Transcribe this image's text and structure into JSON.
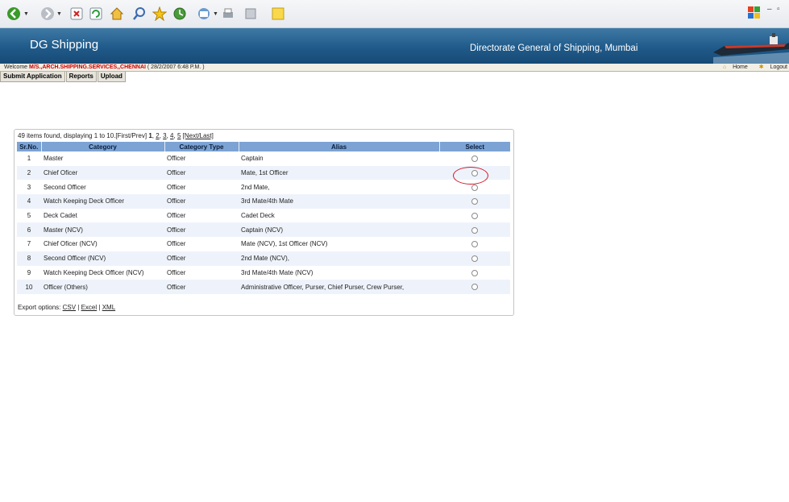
{
  "banner": {
    "title": "DG Shipping",
    "subtitle": "Directorate General of Shipping, Mumbai"
  },
  "welcome": {
    "prefix": "Welcome",
    "company": "M/S.,ARCH.SHIPPING.SERVICES,,CHENNAI",
    "datetime": "( 28/2/2007 6:48 P.M. )",
    "home_label": "Home",
    "logout_label": "Logout"
  },
  "menu": {
    "submit_application": "Submit Application",
    "reports": "Reports",
    "upload": "Upload"
  },
  "pager": {
    "summary": "49 items found, displaying 1 to 10.",
    "first_prev": "[First/Prev]",
    "current": "1",
    "pages": [
      "2",
      "3",
      "4",
      "5"
    ],
    "next_last": "[Next/Last]"
  },
  "table": {
    "headers": {
      "srno": "Sr.No.",
      "category": "Category",
      "category_type": "Category Type",
      "alias": "Alias",
      "select": "Select"
    },
    "rows": [
      {
        "sr": "1",
        "category": "Master",
        "type": "Officer",
        "alias": "Captain"
      },
      {
        "sr": "2",
        "category": "Chief Oficer",
        "type": "Officer",
        "alias": "Mate, 1st Officer"
      },
      {
        "sr": "3",
        "category": "Second Officer",
        "type": "Officer",
        "alias": "2nd Mate,"
      },
      {
        "sr": "4",
        "category": "Watch Keeping Deck Officer",
        "type": "Officer",
        "alias": "3rd Mate/4th Mate"
      },
      {
        "sr": "5",
        "category": "Deck Cadet",
        "type": "Officer",
        "alias": "Cadet Deck"
      },
      {
        "sr": "6",
        "category": "Master (NCV)",
        "type": "Officer",
        "alias": "Captain (NCV)"
      },
      {
        "sr": "7",
        "category": "Chief Oficer (NCV)",
        "type": "Officer",
        "alias": "Mate (NCV), 1st Officer (NCV)"
      },
      {
        "sr": "8",
        "category": "Second Officer (NCV)",
        "type": "Officer",
        "alias": "2nd Mate (NCV),"
      },
      {
        "sr": "9",
        "category": "Watch Keeping Deck Officer (NCV)",
        "type": "Officer",
        "alias": "3rd Mate/4th Mate (NCV)"
      },
      {
        "sr": "10",
        "category": "Officer (Others)",
        "type": "Officer",
        "alias": "Administrative Officer, Purser, Chief Purser, Crew Purser,"
      }
    ]
  },
  "export": {
    "label": "Export options:",
    "csv": "CSV",
    "excel": "Excel",
    "xml": "XML"
  },
  "colors": {
    "banner": "#1f5a8a",
    "table_header": "#7ca3d3",
    "row_alt": "#eef3fb",
    "highlight": "#d0182a",
    "company_text": "#cc0000"
  }
}
